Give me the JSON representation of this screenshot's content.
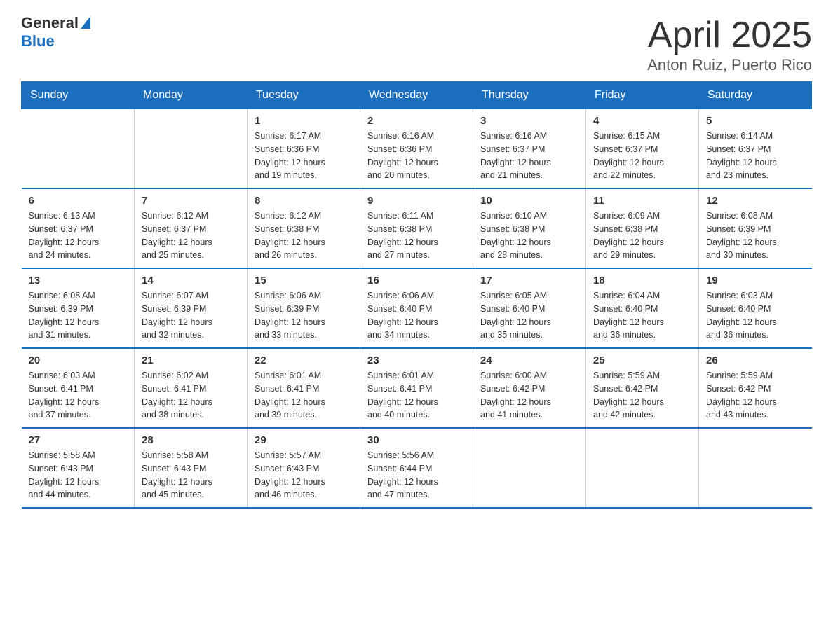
{
  "header": {
    "logo_general": "General",
    "logo_blue": "Blue",
    "month_title": "April 2025",
    "location": "Anton Ruiz, Puerto Rico"
  },
  "days_of_week": [
    "Sunday",
    "Monday",
    "Tuesday",
    "Wednesday",
    "Thursday",
    "Friday",
    "Saturday"
  ],
  "weeks": [
    [
      {
        "day": "",
        "info": ""
      },
      {
        "day": "",
        "info": ""
      },
      {
        "day": "1",
        "info": "Sunrise: 6:17 AM\nSunset: 6:36 PM\nDaylight: 12 hours\nand 19 minutes."
      },
      {
        "day": "2",
        "info": "Sunrise: 6:16 AM\nSunset: 6:36 PM\nDaylight: 12 hours\nand 20 minutes."
      },
      {
        "day": "3",
        "info": "Sunrise: 6:16 AM\nSunset: 6:37 PM\nDaylight: 12 hours\nand 21 minutes."
      },
      {
        "day": "4",
        "info": "Sunrise: 6:15 AM\nSunset: 6:37 PM\nDaylight: 12 hours\nand 22 minutes."
      },
      {
        "day": "5",
        "info": "Sunrise: 6:14 AM\nSunset: 6:37 PM\nDaylight: 12 hours\nand 23 minutes."
      }
    ],
    [
      {
        "day": "6",
        "info": "Sunrise: 6:13 AM\nSunset: 6:37 PM\nDaylight: 12 hours\nand 24 minutes."
      },
      {
        "day": "7",
        "info": "Sunrise: 6:12 AM\nSunset: 6:37 PM\nDaylight: 12 hours\nand 25 minutes."
      },
      {
        "day": "8",
        "info": "Sunrise: 6:12 AM\nSunset: 6:38 PM\nDaylight: 12 hours\nand 26 minutes."
      },
      {
        "day": "9",
        "info": "Sunrise: 6:11 AM\nSunset: 6:38 PM\nDaylight: 12 hours\nand 27 minutes."
      },
      {
        "day": "10",
        "info": "Sunrise: 6:10 AM\nSunset: 6:38 PM\nDaylight: 12 hours\nand 28 minutes."
      },
      {
        "day": "11",
        "info": "Sunrise: 6:09 AM\nSunset: 6:38 PM\nDaylight: 12 hours\nand 29 minutes."
      },
      {
        "day": "12",
        "info": "Sunrise: 6:08 AM\nSunset: 6:39 PM\nDaylight: 12 hours\nand 30 minutes."
      }
    ],
    [
      {
        "day": "13",
        "info": "Sunrise: 6:08 AM\nSunset: 6:39 PM\nDaylight: 12 hours\nand 31 minutes."
      },
      {
        "day": "14",
        "info": "Sunrise: 6:07 AM\nSunset: 6:39 PM\nDaylight: 12 hours\nand 32 minutes."
      },
      {
        "day": "15",
        "info": "Sunrise: 6:06 AM\nSunset: 6:39 PM\nDaylight: 12 hours\nand 33 minutes."
      },
      {
        "day": "16",
        "info": "Sunrise: 6:06 AM\nSunset: 6:40 PM\nDaylight: 12 hours\nand 34 minutes."
      },
      {
        "day": "17",
        "info": "Sunrise: 6:05 AM\nSunset: 6:40 PM\nDaylight: 12 hours\nand 35 minutes."
      },
      {
        "day": "18",
        "info": "Sunrise: 6:04 AM\nSunset: 6:40 PM\nDaylight: 12 hours\nand 36 minutes."
      },
      {
        "day": "19",
        "info": "Sunrise: 6:03 AM\nSunset: 6:40 PM\nDaylight: 12 hours\nand 36 minutes."
      }
    ],
    [
      {
        "day": "20",
        "info": "Sunrise: 6:03 AM\nSunset: 6:41 PM\nDaylight: 12 hours\nand 37 minutes."
      },
      {
        "day": "21",
        "info": "Sunrise: 6:02 AM\nSunset: 6:41 PM\nDaylight: 12 hours\nand 38 minutes."
      },
      {
        "day": "22",
        "info": "Sunrise: 6:01 AM\nSunset: 6:41 PM\nDaylight: 12 hours\nand 39 minutes."
      },
      {
        "day": "23",
        "info": "Sunrise: 6:01 AM\nSunset: 6:41 PM\nDaylight: 12 hours\nand 40 minutes."
      },
      {
        "day": "24",
        "info": "Sunrise: 6:00 AM\nSunset: 6:42 PM\nDaylight: 12 hours\nand 41 minutes."
      },
      {
        "day": "25",
        "info": "Sunrise: 5:59 AM\nSunset: 6:42 PM\nDaylight: 12 hours\nand 42 minutes."
      },
      {
        "day": "26",
        "info": "Sunrise: 5:59 AM\nSunset: 6:42 PM\nDaylight: 12 hours\nand 43 minutes."
      }
    ],
    [
      {
        "day": "27",
        "info": "Sunrise: 5:58 AM\nSunset: 6:43 PM\nDaylight: 12 hours\nand 44 minutes."
      },
      {
        "day": "28",
        "info": "Sunrise: 5:58 AM\nSunset: 6:43 PM\nDaylight: 12 hours\nand 45 minutes."
      },
      {
        "day": "29",
        "info": "Sunrise: 5:57 AM\nSunset: 6:43 PM\nDaylight: 12 hours\nand 46 minutes."
      },
      {
        "day": "30",
        "info": "Sunrise: 5:56 AM\nSunset: 6:44 PM\nDaylight: 12 hours\nand 47 minutes."
      },
      {
        "day": "",
        "info": ""
      },
      {
        "day": "",
        "info": ""
      },
      {
        "day": "",
        "info": ""
      }
    ]
  ]
}
